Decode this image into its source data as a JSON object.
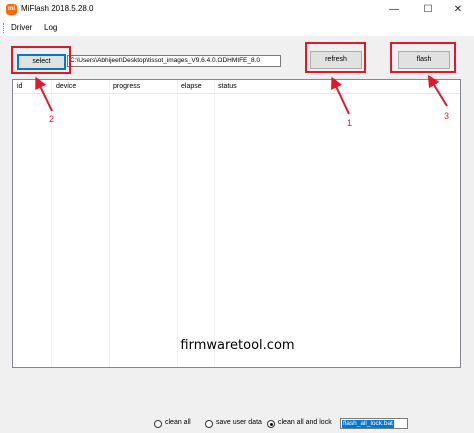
{
  "window": {
    "title": "MiFlash 2018.5.28.0",
    "app_icon": "mi",
    "controls": {
      "minimize": "—",
      "maximize": "☐",
      "close": "✕"
    }
  },
  "menu": {
    "items": [
      "Driver",
      "Log"
    ]
  },
  "toolbar": {
    "select_label": "select",
    "path_value": "C:\\Users\\Abhijeet\\Desktop\\tissot_images_V9.6.4.0.ODHMIFE_8.0",
    "refresh_label": "refresh",
    "flash_label": "flash"
  },
  "grid": {
    "columns": [
      "id",
      "device",
      "progress",
      "elapse",
      "status"
    ],
    "rows": []
  },
  "annotations": {
    "labels": [
      "2",
      "1",
      "3"
    ],
    "color": "#e0182a"
  },
  "watermark": "firmwaretool.com",
  "bottom": {
    "options": [
      "clean all",
      "save user data",
      "clean all and lock"
    ],
    "selected_option": "clean all and lock",
    "script_value": "flash_all_lock.bat"
  }
}
